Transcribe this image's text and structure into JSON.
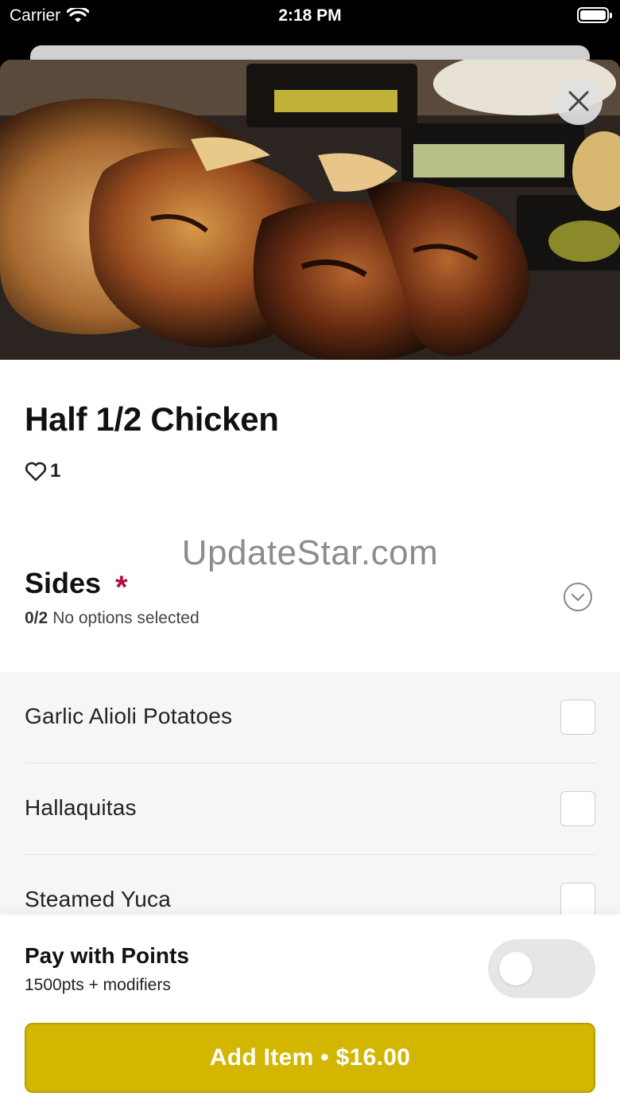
{
  "status_bar": {
    "carrier": "Carrier",
    "time": "2:18 PM"
  },
  "product": {
    "title": "Half 1/2 Chicken",
    "likes": "1"
  },
  "watermark": "UpdateStar.com",
  "sides": {
    "title": "Sides",
    "required_mark": "*",
    "count": "0/2",
    "status": "No options selected",
    "options": [
      {
        "label": "Garlic Alioli Potatoes",
        "checked": false
      },
      {
        "label": "Hallaquitas",
        "checked": false
      },
      {
        "label": "Steamed Yuca",
        "checked": false
      }
    ]
  },
  "pay_with_points": {
    "title": "Pay with Points",
    "subtitle": "1500pts + modifiers",
    "enabled": false
  },
  "add_button": {
    "label": "Add Item • $16.00"
  },
  "colors": {
    "accent": "#d2b600",
    "required": "#b01040"
  },
  "icons": [
    "wifi-icon",
    "battery-icon",
    "close-icon",
    "heart-icon",
    "chevron-down-icon"
  ]
}
